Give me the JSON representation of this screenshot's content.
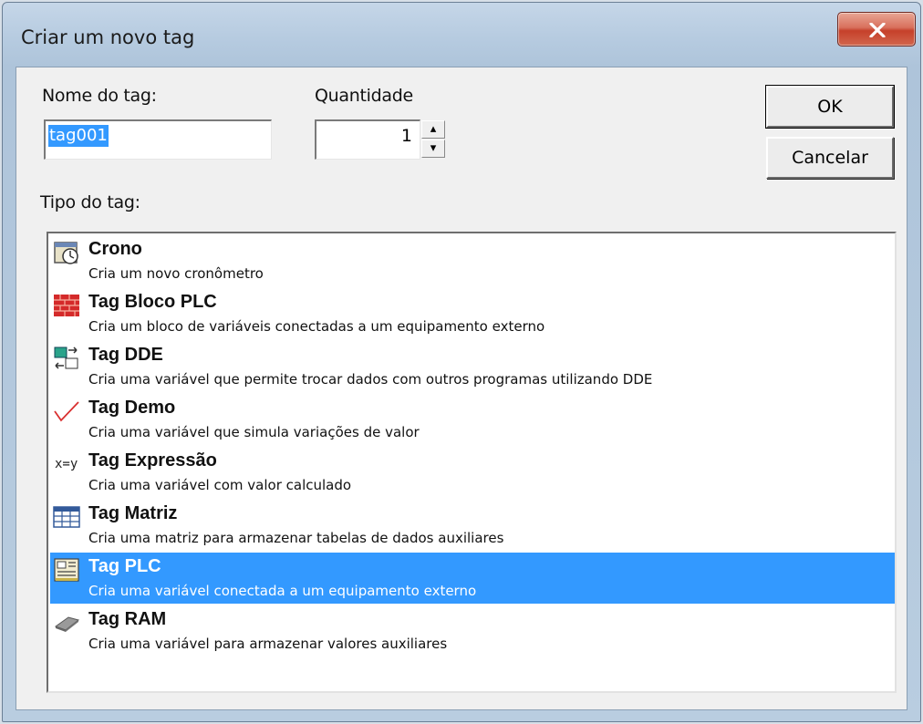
{
  "window": {
    "title": "Criar um novo tag"
  },
  "form": {
    "name_label": "Nome do tag:",
    "name_value": "tag001",
    "quantity_label": "Quantidade",
    "quantity_value": "1",
    "type_label": "Tipo do tag:"
  },
  "buttons": {
    "ok": "OK",
    "cancel": "Cancelar"
  },
  "tag_types": [
    {
      "name": "Crono",
      "desc": "Cria um novo cronômetro",
      "icon": "stopwatch-icon"
    },
    {
      "name": "Tag Bloco PLC",
      "desc": "Cria um bloco de variáveis conectadas a um equipamento externo",
      "icon": "brick-icon"
    },
    {
      "name": "Tag DDE",
      "desc": "Cria uma variável que permite trocar dados com outros programas utilizando DDE",
      "icon": "dde-icon"
    },
    {
      "name": "Tag Demo",
      "desc": "Cria uma variável que simula variações de valor",
      "icon": "checkmark-icon"
    },
    {
      "name": "Tag Expressão",
      "desc": "Cria uma variável com valor calculado",
      "icon": "expression-icon",
      "icon_text": "x=y"
    },
    {
      "name": "Tag Matriz",
      "desc": "Cria uma matriz para armazenar tabelas de dados auxiliares",
      "icon": "grid-icon"
    },
    {
      "name": "Tag PLC",
      "desc": "Cria uma variável conectada a um equipamento externo",
      "icon": "plc-icon"
    },
    {
      "name": "Tag RAM",
      "desc": "Cria uma variável para armazenar valores auxiliares",
      "icon": "memory-icon"
    }
  ],
  "selected_index": 6,
  "colors": {
    "selection": "#3399ff",
    "close_button": "#c6402a"
  }
}
